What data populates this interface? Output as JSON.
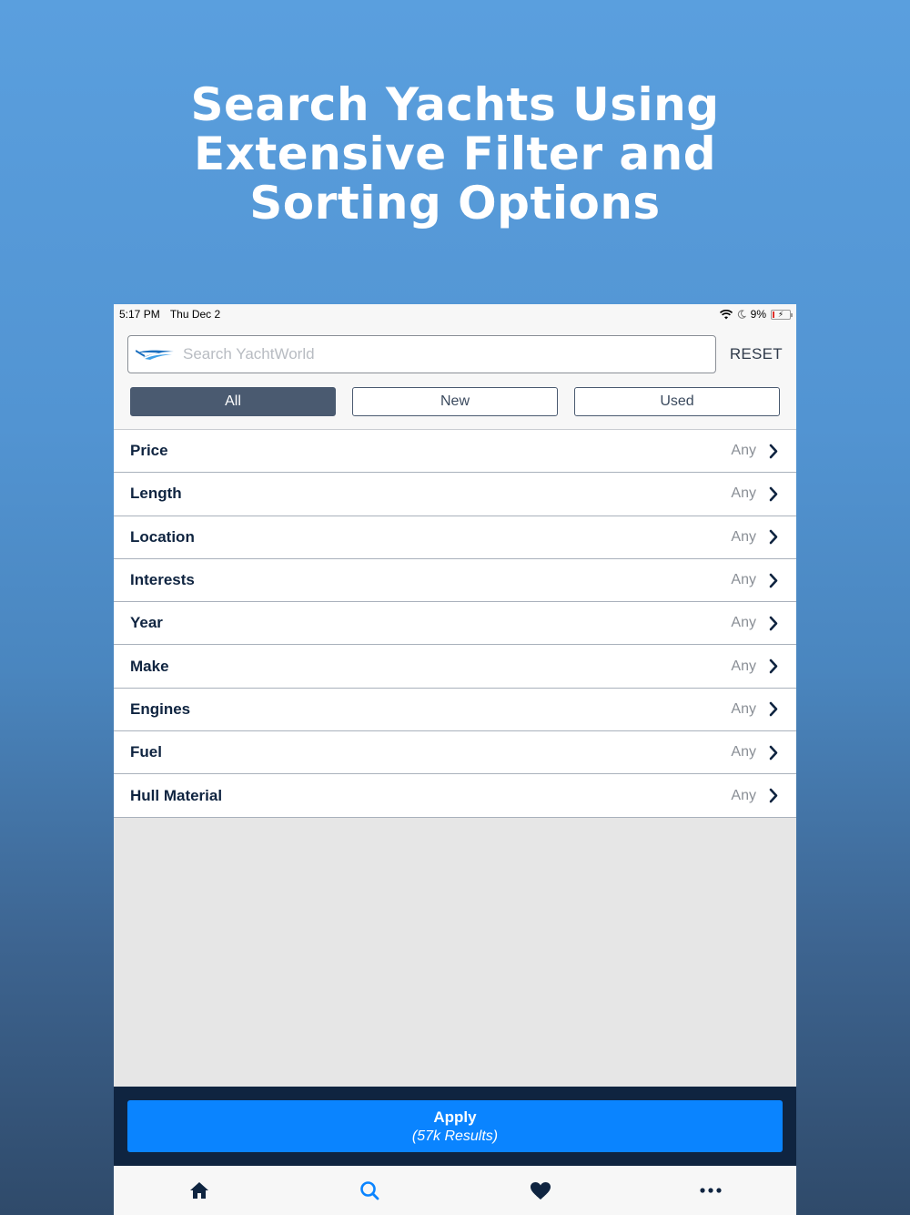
{
  "headline": {
    "line1": "Search Yachts Using",
    "line2": "Extensive Filter and",
    "line3": "Sorting Options"
  },
  "status_bar": {
    "time": "5:17 PM",
    "date": "Thu Dec 2",
    "battery": "9%"
  },
  "search": {
    "placeholder": "Search YachtWorld",
    "value": "",
    "reset_label": "RESET"
  },
  "segments": [
    {
      "label": "All",
      "selected": true
    },
    {
      "label": "New",
      "selected": false
    },
    {
      "label": "Used",
      "selected": false
    }
  ],
  "filters": [
    {
      "label": "Price",
      "value": "Any"
    },
    {
      "label": "Length",
      "value": "Any"
    },
    {
      "label": "Location",
      "value": "Any"
    },
    {
      "label": "Interests",
      "value": "Any"
    },
    {
      "label": "Year",
      "value": "Any"
    },
    {
      "label": "Make",
      "value": "Any"
    },
    {
      "label": "Engines",
      "value": "Any"
    },
    {
      "label": "Fuel",
      "value": "Any"
    },
    {
      "label": "Hull Material",
      "value": "Any"
    }
  ],
  "apply": {
    "label": "Apply",
    "results": "(57k Results)"
  },
  "tabbar": {
    "items": [
      {
        "icon": "home-icon",
        "active": false
      },
      {
        "icon": "search-icon",
        "active": true
      },
      {
        "icon": "heart-icon",
        "active": false
      },
      {
        "icon": "more-icon",
        "active": false
      }
    ]
  },
  "colors": {
    "navy": "#0f2440",
    "accent": "#0a84ff",
    "segment_active": "#4a5a70"
  }
}
